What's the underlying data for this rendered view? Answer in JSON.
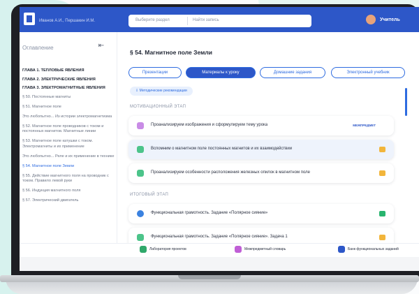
{
  "header": {
    "authors": "Иванов А.И., Першакин И.М.",
    "search_select": "Выберите раздел",
    "search_placeholder": "Найти запись",
    "user": "Учитель"
  },
  "sidebar": {
    "title": "Оглавление",
    "items": [
      {
        "label": "ГЛАВА 1. ТЕПЛОВЫЕ ЯВЛЕНИЯ",
        "type": "ch"
      },
      {
        "label": "ГЛАВА 2. ЭЛЕКТРИЧЕСКИЕ ЯВЛЕНИЯ",
        "type": "ch"
      },
      {
        "label": "ГЛАВА 3. ЭЛЕКТРОМАГНИТНЫЕ ЯВЛЕНИЯ",
        "type": "ch"
      },
      {
        "label": "§ 50. Постоянные магниты",
        "type": "it"
      },
      {
        "label": "§ 51. Магнитное поле",
        "type": "it"
      },
      {
        "label": "Это любопытно... Из истории электромагнетизма",
        "type": "it"
      },
      {
        "label": "§ 52. Магнитное поле проводников с током и постоянных магнитов. Магнитные линии",
        "type": "it"
      },
      {
        "label": "§ 53. Магнитное поле катушки с током. Электромагниты и их применение",
        "type": "it"
      },
      {
        "label": "Это любопытно... Реле и их применение в технике",
        "type": "it"
      },
      {
        "label": "§ 54. Магнитное поле Земли",
        "type": "active"
      },
      {
        "label": "§ 55. Действие магнитного поля на проводник с током. Правило левой руки",
        "type": "it"
      },
      {
        "label": "§ 56. Индукция магнитного поля",
        "type": "it"
      },
      {
        "label": "§ 57. Электрический двигатель",
        "type": "it"
      }
    ]
  },
  "main": {
    "title": "§ 54. Магнитное поле Земли",
    "tabs": [
      "Презентации",
      "Материалы к уроку",
      "Домашние задания",
      "Электронный учебник"
    ],
    "method_button": "Методические рекомендации",
    "section1": "МОТИВАЦИОННЫЙ ЭТАП",
    "section2": "ИТОГОВЫЙ ЭТАП",
    "cards1": [
      {
        "text": "Проанализируем изображения и сформулируем тему урока",
        "tag": "МЕЖПРЕДМЕТ"
      },
      {
        "text": "Вспомним о магнитном поле постоянных магнитов и их взаимодействии",
        "tag": ""
      },
      {
        "text": "Проанализируем особенности расположения железных опилок в магнитном поле",
        "tag": ""
      }
    ],
    "cards2": [
      {
        "text": "Функциональная грамотность. Задание «Полярное сияние»",
        "tag": ""
      },
      {
        "text": "Функциональная грамотность. Задание «Полярное сияние». Задача 1",
        "tag": ""
      }
    ]
  },
  "footer": {
    "items": [
      "Лаборатория проектов",
      "Межпредметный словарь",
      "Банк функциональных заданий"
    ]
  },
  "colors": {
    "brand": "#2d57c8",
    "accent": "#2d6be0",
    "teal": "#d7f2ee"
  }
}
